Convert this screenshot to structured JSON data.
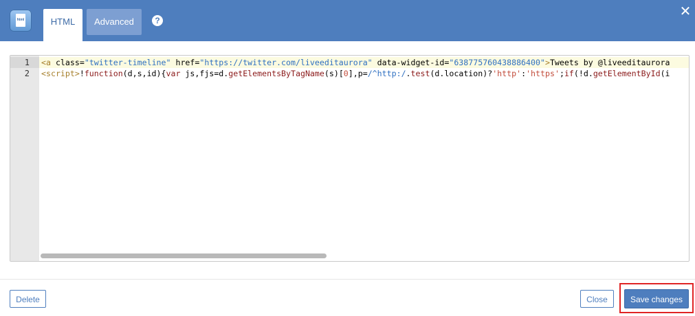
{
  "header": {
    "app_icon_label": "html",
    "tabs": [
      {
        "label": "HTML",
        "active": true
      },
      {
        "label": "Advanced",
        "active": false
      }
    ],
    "help_icon": "?",
    "close_icon": "✕"
  },
  "editor": {
    "line_numbers": [
      "1",
      "2"
    ],
    "line1": {
      "t1": "<a",
      "a1": " class=",
      "s1": "\"twitter-timeline\"",
      "a2": " href=",
      "s2": "\"https://twitter.com/liveeditaurora\"",
      "a3": " data-widget-id=",
      "s3": "\"638775760438886400\"",
      "t2": ">",
      "x1": "Tweets by @liveeditaurora"
    },
    "line2": {
      "t1": "<script>",
      "x1": "!",
      "k1": "function",
      "x2": "(d,s,id){",
      "k2": "var",
      "x3": " js,fjs=d.",
      "k3": "getElementsByTagName",
      "x4": "(s)[",
      "r1": "0",
      "x5": "],p=",
      "s1": "/^http:/",
      "x6": ".",
      "k4": "test",
      "x7": "(d.location)?",
      "r2": "'http'",
      "x8": ":",
      "r3": "'https'",
      "x9": ";",
      "k5": "if",
      "x10": "(!d.",
      "k6": "getElementById",
      "x11": "(i"
    }
  },
  "footer": {
    "delete_label": "Delete",
    "close_label": "Close",
    "save_label": "Save changes"
  },
  "colors": {
    "header": "#4e7ebe",
    "accent": "#4e7ebe",
    "highlight": "#e02424"
  }
}
